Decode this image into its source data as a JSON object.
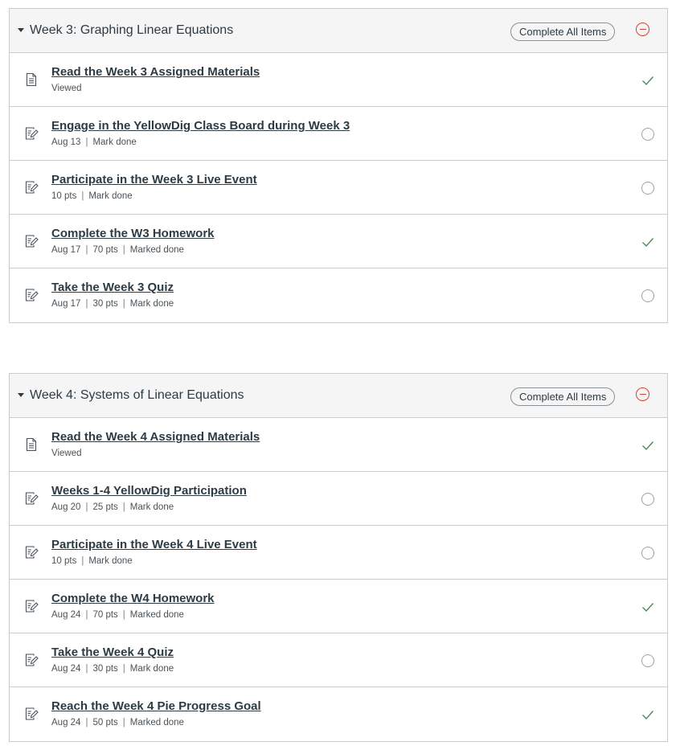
{
  "colors": {
    "check": "#4a8a5a",
    "collapse_icon": "#d0453a",
    "border": "#c7cdd1",
    "header_bg": "#f5f5f5"
  },
  "modules": [
    {
      "title": "Week 3: Graphing Linear Equations",
      "complete_all_label": "Complete All Items",
      "items": [
        {
          "title": "Read the Week 3 Assigned Materials",
          "meta": [
            "Viewed"
          ],
          "icon": "page-icon",
          "status": "done"
        },
        {
          "title": "Engage in the YellowDig Class Board during Week 3",
          "meta": [
            "Aug 13",
            "Mark done"
          ],
          "icon": "assignment-icon",
          "status": "open"
        },
        {
          "title": "Participate in the Week 3 Live Event",
          "meta": [
            "10 pts",
            "Mark done"
          ],
          "icon": "assignment-icon",
          "status": "open"
        },
        {
          "title": "Complete the W3 Homework",
          "meta": [
            "Aug 17",
            "70 pts",
            "Marked done"
          ],
          "icon": "assignment-icon",
          "status": "done"
        },
        {
          "title": "Take the Week 3 Quiz",
          "meta": [
            "Aug 17",
            "30 pts",
            "Mark done"
          ],
          "icon": "assignment-icon",
          "status": "open"
        }
      ]
    },
    {
      "title": "Week 4: Systems of Linear Equations",
      "complete_all_label": "Complete All Items",
      "items": [
        {
          "title": "Read the Week 4 Assigned Materials",
          "meta": [
            "Viewed"
          ],
          "icon": "page-icon",
          "status": "done"
        },
        {
          "title": "Weeks 1-4 YellowDig Participation",
          "meta": [
            "Aug 20",
            "25 pts",
            "Mark done"
          ],
          "icon": "assignment-icon",
          "status": "open"
        },
        {
          "title": "Participate in the Week 4 Live Event",
          "meta": [
            "10 pts",
            "Mark done"
          ],
          "icon": "assignment-icon",
          "status": "open"
        },
        {
          "title": "Complete the W4 Homework",
          "meta": [
            "Aug 24",
            "70 pts",
            "Marked done"
          ],
          "icon": "assignment-icon",
          "status": "done"
        },
        {
          "title": "Take the Week 4 Quiz",
          "meta": [
            "Aug 24",
            "30 pts",
            "Mark done"
          ],
          "icon": "assignment-icon",
          "status": "open"
        },
        {
          "title": "Reach the Week 4 Pie Progress Goal",
          "meta": [
            "Aug 24",
            "50 pts",
            "Marked done"
          ],
          "icon": "assignment-icon",
          "status": "done"
        }
      ]
    }
  ]
}
